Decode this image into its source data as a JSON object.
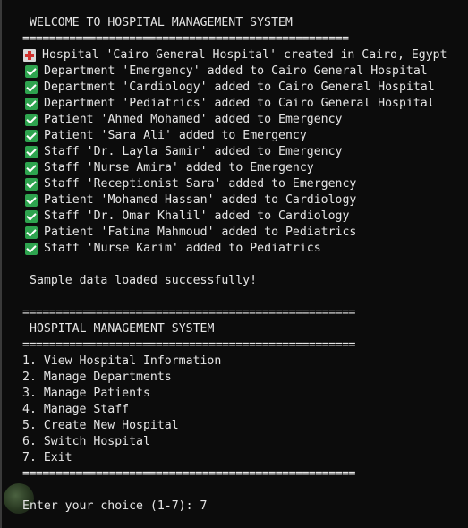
{
  "header": {
    "welcome": "WELCOME TO HOSPITAL MANAGEMENT SYSTEM",
    "separator_long": "================================================="
  },
  "log": {
    "hospital_created": "Hospital 'Cairo General Hospital' created in Cairo, Egypt",
    "entries": [
      "Department 'Emergency' added to Cairo General Hospital",
      "Department 'Cardiology' added to Cairo General Hospital",
      "Department 'Pediatrics' added to Cairo General Hospital",
      "Patient 'Ahmed Mohamed' added to Emergency",
      "Patient 'Sara Ali' added to Emergency",
      "Staff 'Dr. Layla Samir' added to Emergency",
      "Staff 'Nurse Amira' added to Emergency",
      "Staff 'Receptionist Sara' added to Emergency",
      "Patient 'Mohamed Hassan' added to Cardiology",
      "Staff 'Dr. Omar Khalil' added to Cardiology",
      "Patient 'Fatima Mahmoud' added to Pediatrics",
      "Staff 'Nurse Karim' added to Pediatrics"
    ],
    "loaded_message": "Sample data loaded successfully!"
  },
  "menu": {
    "separator": "==================================================",
    "title": "HOSPITAL MANAGEMENT SYSTEM",
    "options": [
      "1. View Hospital Information",
      "2. Manage Departments",
      "3. Manage Patients",
      "4. Manage Staff",
      "5. Create New Hospital",
      "6. Switch Hospital",
      "7. Exit"
    ]
  },
  "prompt": {
    "text": "Enter your choice (1-7): ",
    "input_value": "7"
  },
  "colors": {
    "background": "#0c0c0c",
    "text": "#e6e6e6",
    "check_green": "#2ea44f"
  },
  "icons": {
    "hospital": "hospital-icon",
    "check": "check-mark-icon"
  }
}
